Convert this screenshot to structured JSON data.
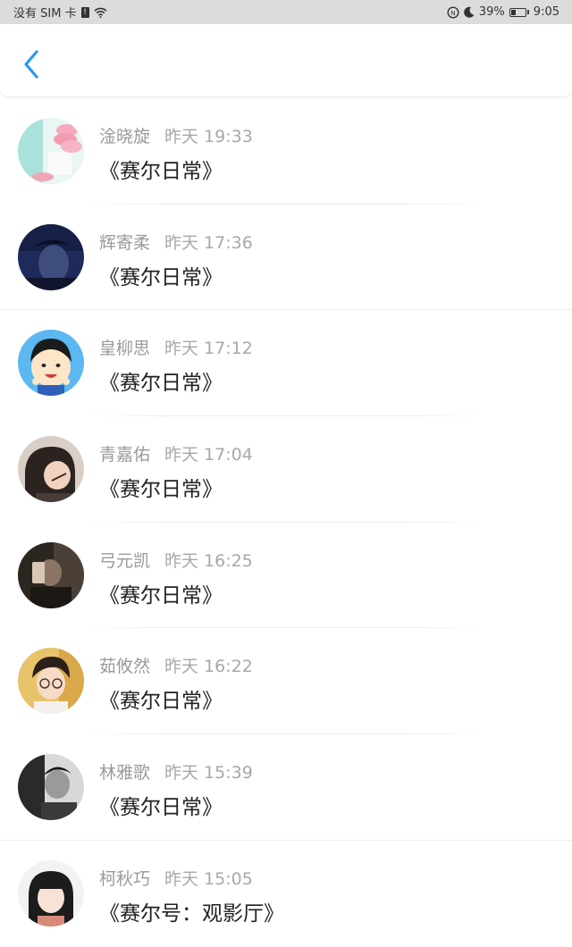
{
  "status_bar": {
    "carrier": "没有 SIM 卡",
    "battery": "39%",
    "battery_level": 0.39,
    "time": "9:05"
  },
  "nav": {
    "back_icon": "chevron-left-icon",
    "accent_color": "#2a9af0"
  },
  "comments": [
    {
      "name": "淦晓旋",
      "time": "昨天 19:33",
      "title": "《赛尔日常》",
      "avatar": "pink-macaron"
    },
    {
      "name": "辉寄柔",
      "time": "昨天 17:36",
      "title": "《赛尔日常》",
      "avatar": "dark-portrait"
    },
    {
      "name": "皇柳思",
      "time": "昨天 17:12",
      "title": "《赛尔日常》",
      "avatar": "cartoon-boy"
    },
    {
      "name": "青嘉佑",
      "time": "昨天 17:04",
      "title": "《赛尔日常》",
      "avatar": "child-portrait"
    },
    {
      "name": "弓元凯",
      "time": "昨天 16:25",
      "title": "《赛尔日常》",
      "avatar": "mirror-selfie"
    },
    {
      "name": "茹攸然",
      "time": "昨天 16:22",
      "title": "《赛尔日常》",
      "avatar": "glasses-portrait"
    },
    {
      "name": "林雅歌",
      "time": "昨天 15:39",
      "title": "《赛尔日常》",
      "avatar": "bw-portrait"
    },
    {
      "name": "柯秋巧",
      "time": "昨天 15:05",
      "title": "《赛尔号：观影厅》",
      "avatar": "girl-portrait"
    }
  ]
}
